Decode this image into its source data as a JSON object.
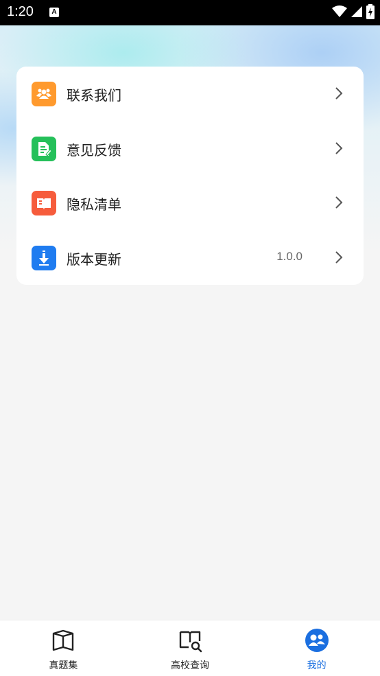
{
  "status_bar": {
    "time": "1:20",
    "notification_letter": "A"
  },
  "menu": [
    {
      "label": "联系我们",
      "value": "",
      "icon": "contact-icon",
      "color": "#ff9a2e"
    },
    {
      "label": "意见反馈",
      "value": "",
      "icon": "feedback-icon",
      "color": "#25c05a"
    },
    {
      "label": "隐私清单",
      "value": "",
      "icon": "privacy-icon",
      "color": "#f65c3c"
    },
    {
      "label": "版本更新",
      "value": "1.0.0",
      "icon": "download-icon",
      "color": "#1f7cf0"
    }
  ],
  "tabbar": {
    "tabs": [
      {
        "label": "真题集",
        "icon": "book-icon",
        "active": false
      },
      {
        "label": "高校查询",
        "icon": "book-search-icon",
        "active": false
      },
      {
        "label": "我的",
        "icon": "profile-icon",
        "active": true
      }
    ],
    "active_color": "#1b6fe0"
  }
}
